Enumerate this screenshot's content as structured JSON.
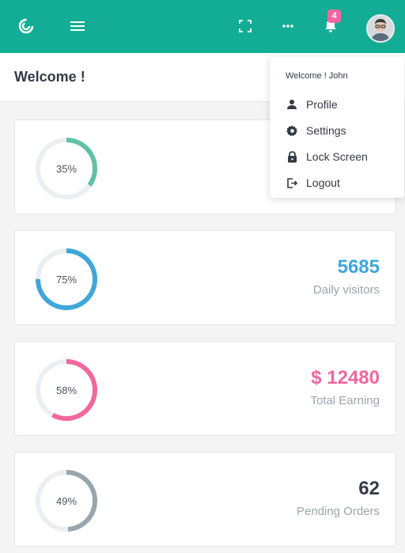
{
  "topbar": {
    "bg_color": "#13ad95",
    "logo_icon": "logo-swirl-icon",
    "menu_icon": "hamburger-icon",
    "fullscreen_icon": "fullscreen-icon",
    "more_icon": "more-dots-icon",
    "notification_icon": "bell-icon",
    "notification_count": "4"
  },
  "header": {
    "title": "Welcome !"
  },
  "cards": [
    {
      "percent": 35,
      "percent_label": "35%",
      "value": "",
      "label": "",
      "color": "#5fc2a6"
    },
    {
      "percent": 75,
      "percent_label": "75%",
      "value": "5685",
      "label": "Daily visitors",
      "color": "#3fa6da"
    },
    {
      "percent": 58,
      "percent_label": "58%",
      "value": "$ 12480",
      "label": "Total Earning",
      "color": "#f1679e"
    },
    {
      "percent": 49,
      "percent_label": "49%",
      "value": "62",
      "label": "Pending Orders",
      "color": "#98a6ad"
    }
  ],
  "dropdown": {
    "greeting": "Welcome ! John",
    "items": [
      {
        "label": "Profile",
        "icon": "user-icon"
      },
      {
        "label": "Settings",
        "icon": "gear-icon"
      },
      {
        "label": "Lock Screen",
        "icon": "lock-icon"
      },
      {
        "label": "Logout",
        "icon": "logout-icon"
      }
    ]
  }
}
